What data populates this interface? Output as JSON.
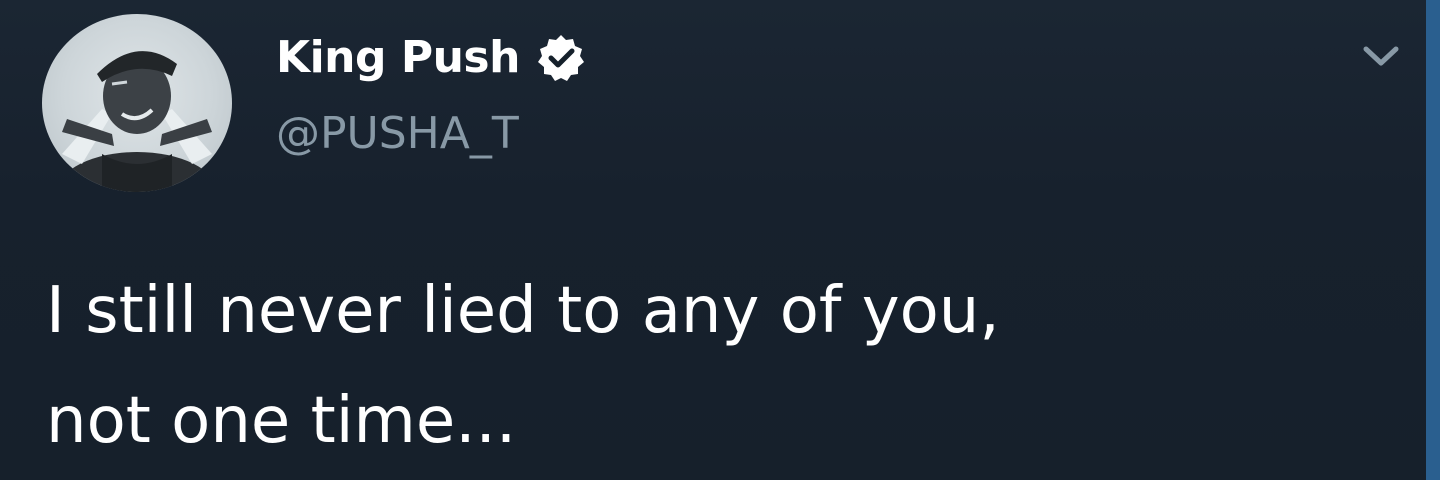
{
  "author": {
    "display_name": "King Push",
    "handle": "@PUSHA_T",
    "verified": true,
    "avatar_icon": "profile-photo"
  },
  "tweet": {
    "text": "I still never lied to any of you,\nnot one time..."
  },
  "icons": {
    "verified": "verified-badge-icon",
    "menu": "chevron-down-icon"
  },
  "colors": {
    "background": "#15202b",
    "text_primary": "#ffffff",
    "text_secondary": "#8899a6",
    "edge_accent": "#2a5f8f"
  }
}
